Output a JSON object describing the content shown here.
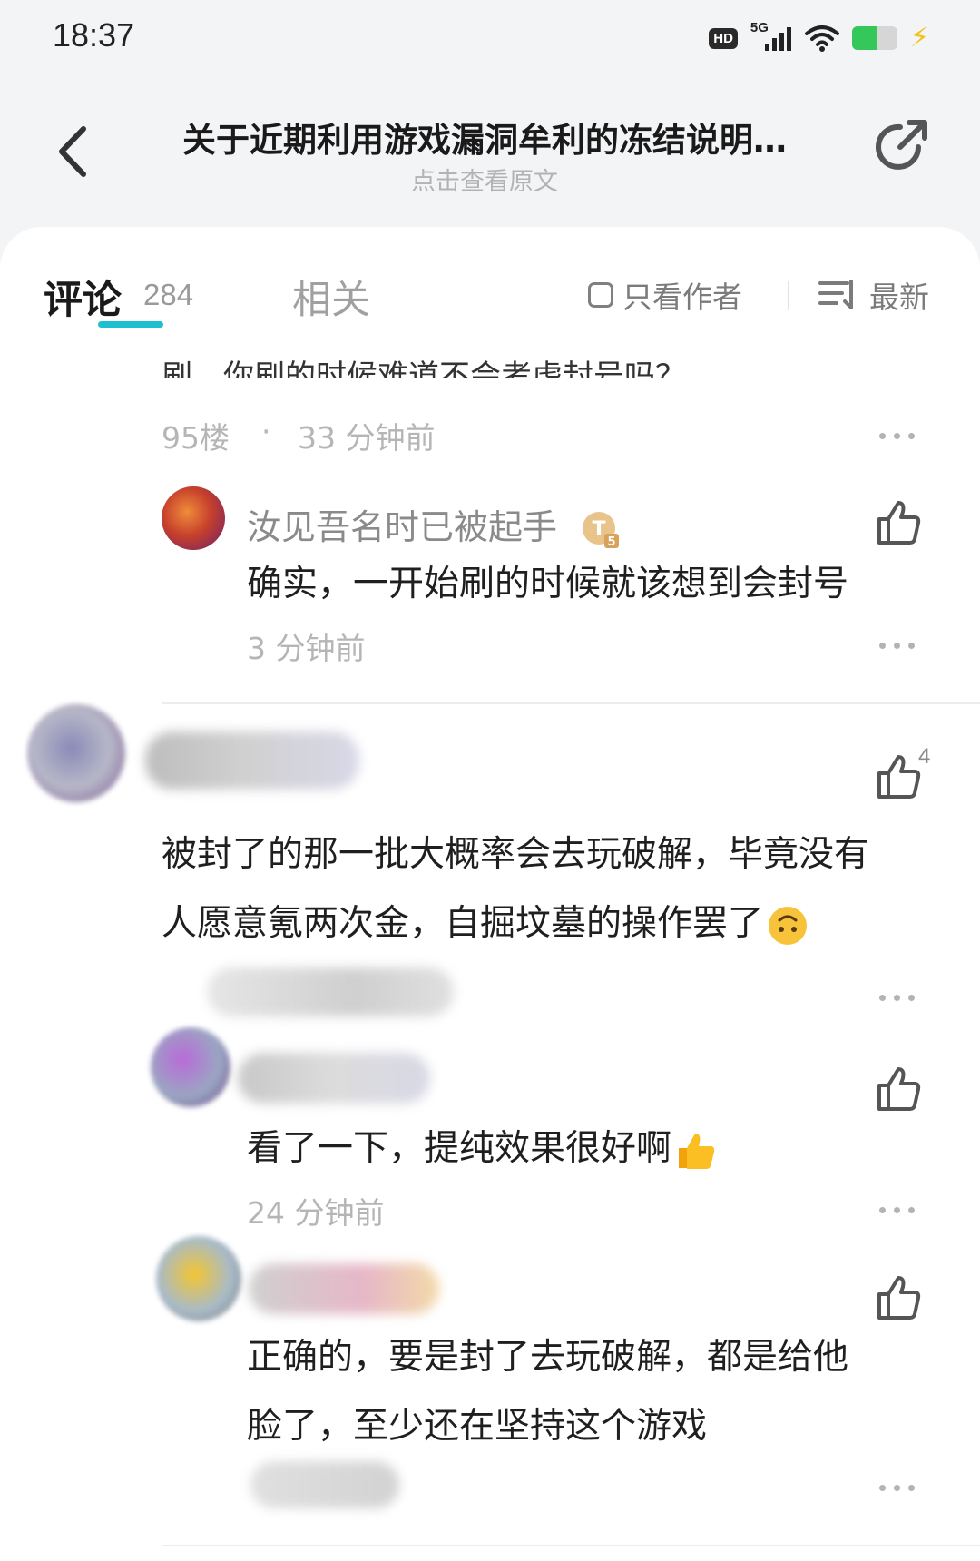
{
  "status_bar": {
    "time": "18:37",
    "hd_label": "HD",
    "network_label": "5G",
    "battery_level": 0.55
  },
  "header": {
    "title": "关于近期利用游戏漏洞牟利的冻结说明…",
    "subtitle": "点击查看原文"
  },
  "tabs": {
    "comments_label": "评论",
    "comments_count": "284",
    "related_label": "相关",
    "only_author_label": "只看作者",
    "sort_label": "最新"
  },
  "thread": {
    "cut_text": "刷，你刷的时候难道不会考虑封号吗？",
    "floor": "95楼",
    "separator": "·",
    "time": "33 分钟前",
    "reply": {
      "username": "汝见吾名时已被起手",
      "badge": "T5",
      "text": "确实，一开始刷的时候就该想到会封号",
      "time": "3 分钟前"
    }
  },
  "comment": {
    "like_count": "4",
    "text_lines": [
      "被封了的那一批大概率会去玩破解，毕竟没有",
      "人愿意氪两次金，自掘坟墓的操作罢了"
    ],
    "emoji": "upside-down-face",
    "replies": [
      {
        "text": "看了一下，提纯效果很好啊",
        "emoji": "thumbs-up",
        "time": "24 分钟前"
      },
      {
        "text_lines": [
          "正确的，要是封了去玩破解，都是给他",
          "脸了，至少还在坚持这个游戏"
        ]
      }
    ]
  },
  "colors": {
    "accent": "#1ec0cf",
    "muted": "#b5b5b5",
    "text": "#1f1f1f",
    "background": "#f3f4f6"
  }
}
